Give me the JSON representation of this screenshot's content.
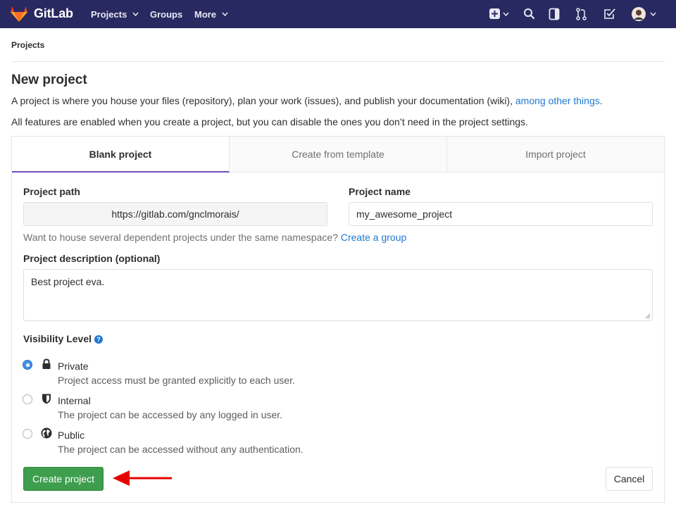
{
  "navbar": {
    "brand": "GitLab",
    "links": [
      "Projects",
      "Groups",
      "More"
    ],
    "icons": [
      "plus-square-icon",
      "search-icon",
      "sidebar-icon",
      "merge-request-icon",
      "todo-check-icon",
      "avatar"
    ],
    "bg_color": "#292961"
  },
  "breadcrumb": "Projects",
  "page": {
    "title": "New project",
    "intro_text": "A project is where you house your files (repository), plan your work (issues), and publish your documentation (wiki), ",
    "intro_link": "among other things",
    "intro_end": ".",
    "features_text": "All features are enabled when you create a project, but you can disable the ones you don’t need in the project settings."
  },
  "tabs": [
    {
      "label": "Blank project",
      "active": true
    },
    {
      "label": "Create from template",
      "active": false
    },
    {
      "label": "Import project",
      "active": false
    }
  ],
  "form": {
    "project_path_label": "Project path",
    "project_path_value": "https://gitlab.com/gnclmorais/",
    "project_name_label": "Project name",
    "project_name_value": "my_awesome_project",
    "group_help_text": "Want to house several dependent projects under the same namespace? ",
    "group_help_link": "Create a group",
    "description_label": "Project description (optional)",
    "description_value": "Best project eva.",
    "visibility_label": "Visibility Level",
    "visibility_options": [
      {
        "title": "Private",
        "desc": "Project access must be granted explicitly to each user.",
        "checked": true,
        "icon": "lock-icon"
      },
      {
        "title": "Internal",
        "desc": "The project can be accessed by any logged in user.",
        "checked": false,
        "icon": "shield-icon"
      },
      {
        "title": "Public",
        "desc": "The project can be accessed without any authentication.",
        "checked": false,
        "icon": "globe-icon"
      }
    ],
    "create_button": "Create project",
    "cancel_button": "Cancel"
  },
  "colors": {
    "accent": "#6b4fbb",
    "link": "#1f78d1",
    "create_button": "#3e9e4e",
    "annotation_arrow": "#e60000"
  }
}
